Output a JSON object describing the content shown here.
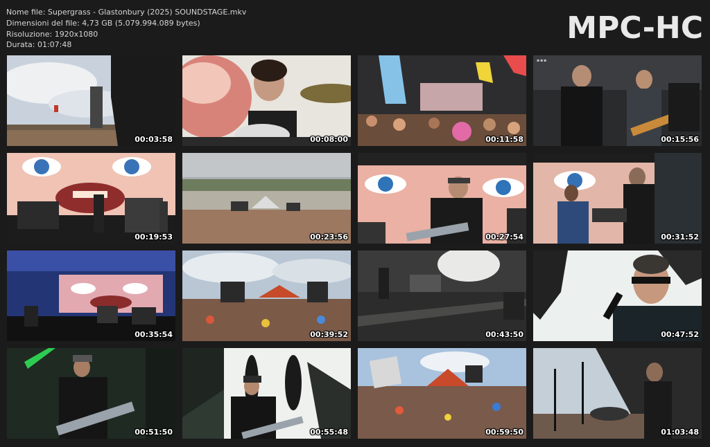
{
  "file_info": {
    "name_line": "Nome file: Supergrass - Glastonbury (2025) SOUNDSTAGE.mkv",
    "size_line": "Dimensioni del file: 4,73 GB (5.079.994.089 bytes)",
    "resolution_line": "Risoluzione: 1920x1080",
    "duration_line": "Durata: 01:07:48"
  },
  "logo": "MPC-HC",
  "thumbnails": [
    {
      "time": "00:03:58",
      "scene": "stage-tower-sky"
    },
    {
      "time": "00:08:00",
      "scene": "drummer-closeup"
    },
    {
      "time": "00:11:58",
      "scene": "crowd-flags"
    },
    {
      "time": "00:15:56",
      "scene": "band-dark-stage"
    },
    {
      "time": "00:19:53",
      "scene": "face-screen-band"
    },
    {
      "time": "00:23:56",
      "scene": "festival-wide"
    },
    {
      "time": "00:27:54",
      "scene": "guitarist-face-screen"
    },
    {
      "time": "00:31:52",
      "scene": "keys-player-face-screen"
    },
    {
      "time": "00:35:54",
      "scene": "blue-stage-wide"
    },
    {
      "time": "00:39:52",
      "scene": "pyramid-crowd"
    },
    {
      "time": "00:43:50",
      "scene": "stage-floor-dark"
    },
    {
      "time": "00:47:52",
      "scene": "singer-closeup"
    },
    {
      "time": "00:51:50",
      "scene": "guitarist-green"
    },
    {
      "time": "00:55:48",
      "scene": "singer-white-screen"
    },
    {
      "time": "00:59:50",
      "scene": "crowd-pyramid-flags"
    },
    {
      "time": "01:03:48",
      "scene": "drummer-sky"
    }
  ],
  "colors": {
    "background": "#1b1b1b",
    "text": "#d6d6d6",
    "logo": "#e9e9e9"
  }
}
